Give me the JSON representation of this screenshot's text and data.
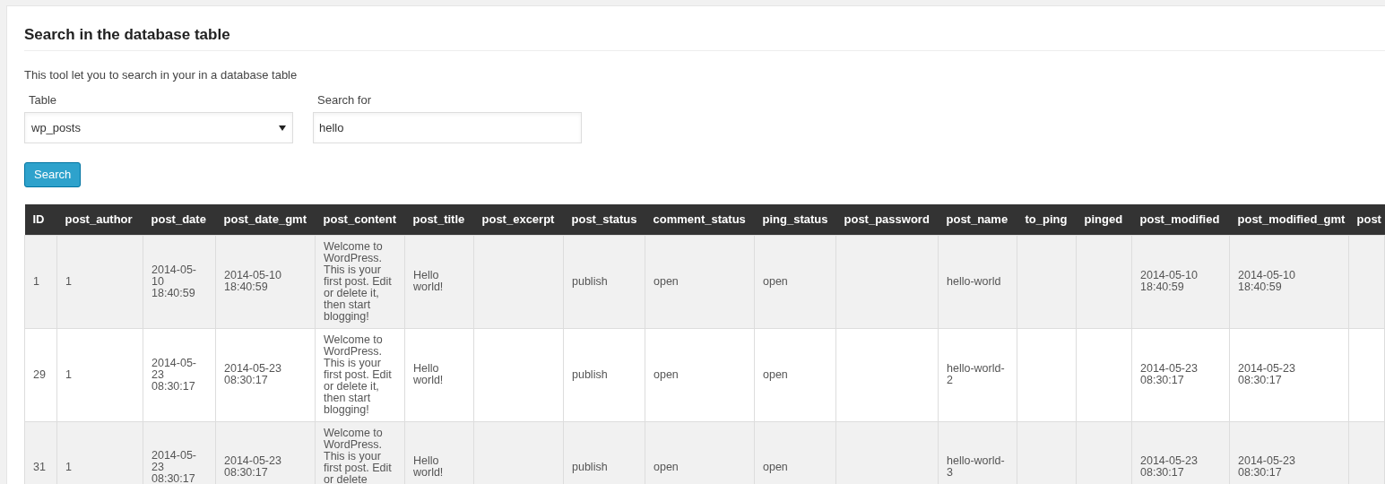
{
  "panel": {
    "title": "Search in the database table",
    "description": "This tool let you to search in your in a database table"
  },
  "form": {
    "table_label": "Table",
    "table_value": "wp_posts",
    "search_label": "Search for",
    "search_value": "hello",
    "button": "Search"
  },
  "table": {
    "columns": [
      "ID",
      "post_author",
      "post_date",
      "post_date_gmt",
      "post_content",
      "post_title",
      "post_excerpt",
      "post_status",
      "comment_status",
      "ping_status",
      "post_password",
      "post_name",
      "to_ping",
      "pinged",
      "post_modified",
      "post_modified_gmt",
      "post"
    ],
    "rows": [
      [
        "1",
        "1",
        "2014-05-10 18:40:59",
        "2014-05-10 18:40:59",
        "Welcome to WordPress. This is your first post. Edit or delete it, then start blogging!",
        "Hello world!",
        "",
        "publish",
        "open",
        "open",
        "",
        "hello-world",
        "",
        "",
        "2014-05-10 18:40:59",
        "2014-05-10 18:40:59",
        ""
      ],
      [
        "29",
        "1",
        "2014-05-23 08:30:17",
        "2014-05-23 08:30:17",
        "Welcome to WordPress. This is your first post. Edit or delete it, then start blogging!",
        "Hello world!",
        "",
        "publish",
        "open",
        "open",
        "",
        "hello-world-2",
        "",
        "",
        "2014-05-23 08:30:17",
        "2014-05-23 08:30:17",
        ""
      ],
      [
        "31",
        "1",
        "2014-05-23 08:30:17",
        "2014-05-23 08:30:17",
        "Welcome to WordPress. This is your first post. Edit or delete",
        "Hello world!",
        "",
        "publish",
        "open",
        "open",
        "",
        "hello-world-3",
        "",
        "",
        "2014-05-23 08:30:17",
        "2014-05-23 08:30:17",
        ""
      ]
    ]
  }
}
